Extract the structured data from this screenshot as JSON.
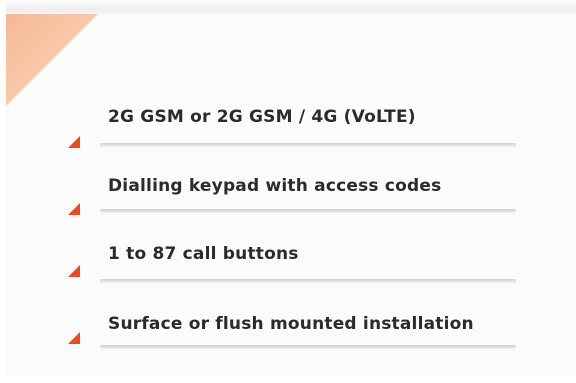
{
  "colors": {
    "accent": "#ee4a1e",
    "corner": "#f7c8a8",
    "text": "#2b2b2b",
    "divider": "#d8d8d8"
  },
  "features": [
    {
      "label": "2G GSM or 2G GSM / 4G (VoLTE)",
      "icon": "triangle-bullet-icon"
    },
    {
      "label": "Dialling  keypad with access codes",
      "icon": "triangle-bullet-icon"
    },
    {
      "label": "1 to 87 call buttons",
      "icon": "triangle-bullet-icon"
    },
    {
      "label": "Surface or flush mounted installation",
      "icon": "triangle-bullet-icon"
    }
  ]
}
